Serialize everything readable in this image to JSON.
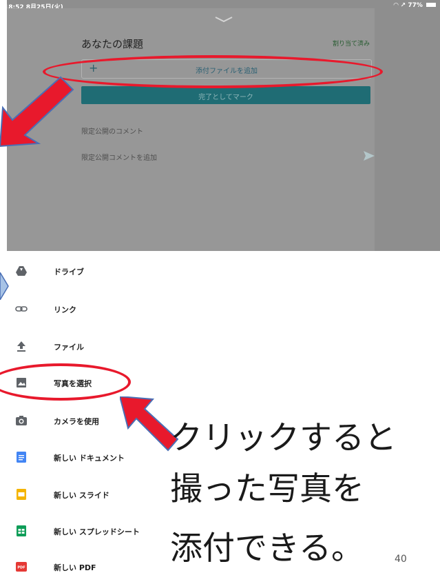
{
  "status_bar": {
    "time": "18:52  8月25日(火)",
    "right": "77%"
  },
  "sheet": {
    "title": "あなたの課題",
    "assigned": "割り当て済み",
    "attach_plus": "+",
    "attach_label": "添付ファイルを追加",
    "mark_done_label": "完了としてマーク",
    "private_comments_header": "限定公開のコメント",
    "add_private_comment": "限定公開コメントを追加"
  },
  "menu": [
    {
      "label": "ドライブ",
      "icon": "drive-icon"
    },
    {
      "label": "リンク",
      "icon": "link-icon"
    },
    {
      "label": "ファイル",
      "icon": "upload-icon"
    },
    {
      "label": "写真を選択",
      "icon": "photo-icon"
    },
    {
      "label": "カメラを使用",
      "icon": "camera-icon"
    },
    {
      "label": "新しい ドキュメント",
      "icon": "docs-icon"
    },
    {
      "label": "新しい スライド",
      "icon": "slides-icon"
    },
    {
      "label": "新しい スプレッドシート",
      "icon": "sheets-icon"
    },
    {
      "label": "新しい PDF",
      "icon": "pdf-icon"
    }
  ],
  "annotation": {
    "line1": "クリックすると",
    "line2": "撮った写真を",
    "line3": "添付できる。",
    "page_number": "40"
  },
  "colors": {
    "highlight_red": "#e8192c",
    "button_teal": "#1f6c74",
    "docs_blue": "#4285f4",
    "slides_yellow": "#f4b400",
    "sheets_green": "#0f9d58",
    "pdf_red": "#e53935"
  }
}
